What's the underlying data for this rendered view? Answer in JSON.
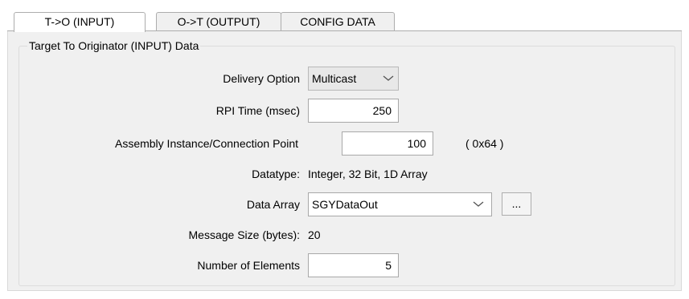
{
  "tabs": [
    {
      "label": "T->O (INPUT)"
    },
    {
      "label": "O->T (OUTPUT)"
    },
    {
      "label": "CONFIG DATA"
    }
  ],
  "group_title": "Target To Originator (INPUT) Data",
  "fields": {
    "delivery_option": {
      "label": "Delivery Option",
      "value": "Multicast"
    },
    "rpi_time": {
      "label": "RPI Time (msec)",
      "value": "250"
    },
    "assembly_instance": {
      "label": "Assembly Instance/Connection Point",
      "value": "100",
      "hex": "( 0x64 )"
    },
    "datatype": {
      "label": "Datatype:",
      "value": "Integer, 32 Bit, 1D Array"
    },
    "data_array": {
      "label": "Data Array",
      "value": "SGYDataOut",
      "browse_label": "..."
    },
    "message_size": {
      "label": "Message Size (bytes):",
      "value": "20"
    },
    "number_of_elements": {
      "label": "Number of Elements",
      "value": "5"
    }
  },
  "icons": {
    "dropdown": "chevron-down-icon"
  }
}
